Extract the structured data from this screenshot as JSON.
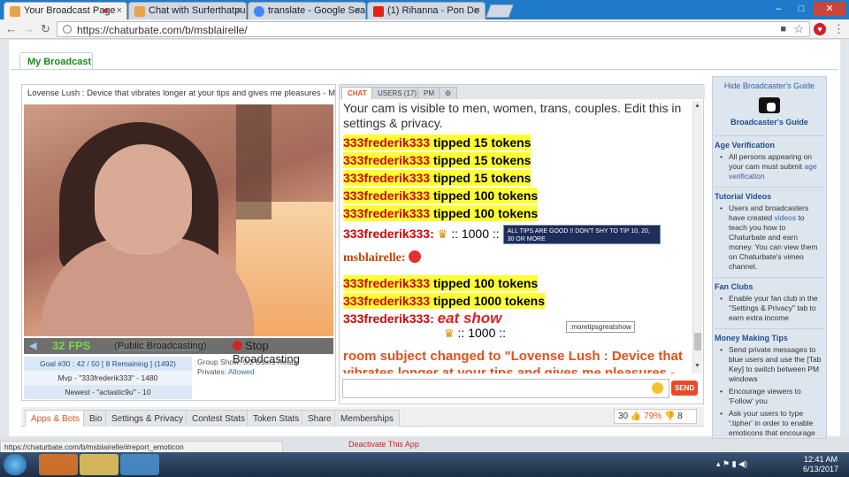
{
  "browser": {
    "tabs": [
      {
        "label": "Your Broadcast Page",
        "color": "#e8a24a",
        "active": true
      },
      {
        "label": "Chat with Surferthatpuss",
        "color": "#e8a24a",
        "active": false
      },
      {
        "label": "translate - Google Search",
        "color": "#4285f4",
        "active": false
      },
      {
        "label": "(1) Rihanna - Pon De",
        "color": "#e62117",
        "active": false
      }
    ],
    "url": "https://chaturbate.com/b/msblairelle/",
    "window_buttons": [
      "–",
      "□",
      "✕"
    ]
  },
  "page": {
    "main_tab": "My Broadcast"
  },
  "video": {
    "subject": "Lovense Lush : Device that vibrates longer at your tips and gives me pleasures - Multi-",
    "fps": "32 FPS",
    "status": "(Public Broadcasting)",
    "stop_label": "Stop Broadcasting",
    "goal": "Goal #30 : 42 / 50 [ 8 Remaining ] (1492)",
    "mvp": "Mvp - \"333frederik333\" - 1480",
    "newest": "Newest - \"actastic9u\" - 10",
    "group_show": "Group Show: 0/2 Users Ready",
    "privates_label": "Privates:",
    "privates_value": "Allowed"
  },
  "chat": {
    "tabs": [
      "CHAT",
      "USERS (17)",
      "PM"
    ],
    "notice": "Your cam is visible to men, women, trans, couples. Edit this in settings & privacy.",
    "tip_user": "333frederik333",
    "tips": [
      {
        "user": "333frederik333",
        "text": " tipped 15 tokens"
      },
      {
        "user": "333frederik333",
        "text": " tipped 15 tokens"
      },
      {
        "user": "333frederik333",
        "text": " tipped 15 tokens"
      },
      {
        "user": "333frederik333",
        "text": " tipped 100 tokens"
      },
      {
        "user": "333frederik333",
        "text": " tipped 100 tokens"
      }
    ],
    "crown_line_user": "333frederik333:",
    "crown_value": ":: 1000 ::",
    "tip_image_text": "ALL TIPS ARE GOOD !! DON'T SHY TO TIP 10, 20, 30 OR MORE",
    "broadcaster_user": "msblairelle:",
    "tips2": [
      {
        "user": "333frederik333",
        "text": " tipped 100 tokens"
      },
      {
        "user": "333frederik333",
        "text": " tipped 1000 tokens"
      }
    ],
    "crown_line2_user": "333frederik333:",
    "crown_value2": ":: 1000 ::",
    "great_show": "eat show",
    "tooltip": ":moretipsgreatshow",
    "room_subject": "room subject changed to \"Lovense Lush : Device that vibrates longer at your tips and gives me pleasures - Multi-Goal : A surprise #lovense\"",
    "send_label": "SEND"
  },
  "bottom": {
    "tabs": [
      "Apps & Bots",
      "Bio",
      "Settings & Privacy",
      "Contest Stats",
      "Token Stats",
      "Share",
      "Memberships"
    ],
    "upvotes": "30",
    "satisfaction": "79%",
    "downvotes": "8",
    "deactivate": "Deactivate This App",
    "status_url": "https://chaturbate.com/b/msblairelle/#report_emoticon"
  },
  "sidebar": {
    "hide_label": "Hide Broadcaster's Guide",
    "guide_title": "Broadcaster's Guide",
    "sections": [
      {
        "heading": "Age Verification",
        "items": [
          {
            "pre": "All persons appearing on your cam must submit ",
            "link": "age verification",
            "post": ""
          }
        ]
      },
      {
        "heading": "Tutorial Videos",
        "items": [
          {
            "pre": "Users and broadcasters have created ",
            "link": "videos",
            "post": " to teach you how to Chaturbate and earn money. You can view them on Chaturbate's vimeo channel."
          }
        ]
      },
      {
        "heading": "Fan Clubs",
        "items": [
          {
            "pre": "Enable your fan club in the \"Settings & Privacy\" tab to earn extra income",
            "link": "",
            "post": ""
          }
        ]
      },
      {
        "heading": "Money Making Tips",
        "items": [
          {
            "pre": "Send private messages to blue users and use the [Tab Key] to switch between PM windows",
            "link": "",
            "post": ""
          },
          {
            "pre": "Encourage viewers to 'Follow' you",
            "link": "",
            "post": ""
          },
          {
            "pre": "Ask your users to type ':tipher' in order to enable emoticons that encourage members to tip",
            "link": "",
            "post": ""
          }
        ]
      }
    ]
  },
  "taskbar": {
    "time": "12:41 AM",
    "date": "6/13/2017"
  }
}
